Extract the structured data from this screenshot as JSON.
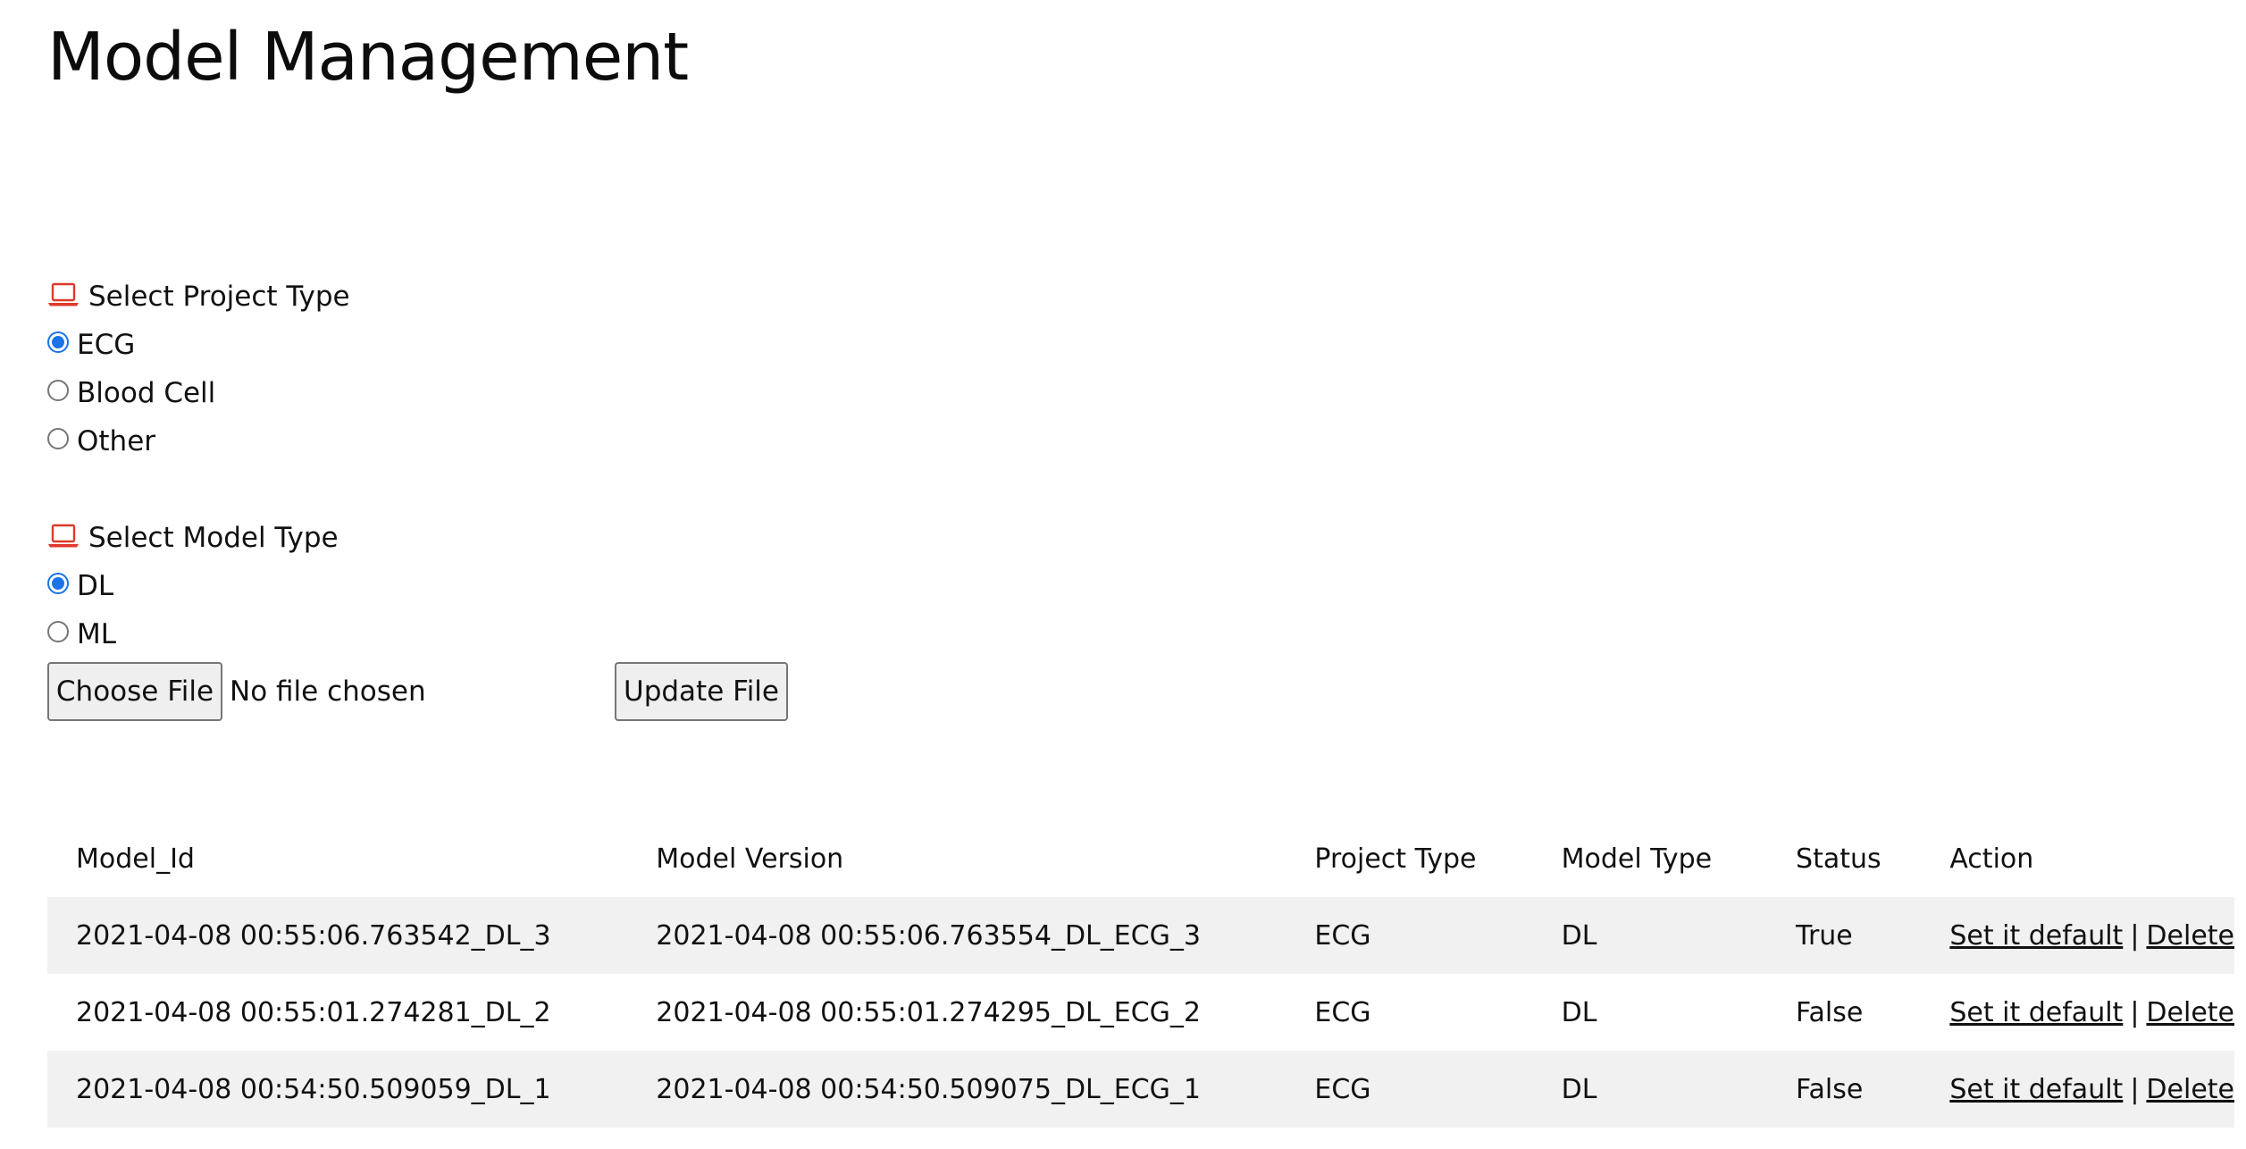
{
  "page": {
    "title": "Model Management"
  },
  "project_type": {
    "heading": "Select Project Type",
    "icon": "laptop-icon",
    "options": [
      {
        "label": "ECG",
        "checked": true
      },
      {
        "label": "Blood Cell",
        "checked": false
      },
      {
        "label": "Other",
        "checked": false
      }
    ]
  },
  "model_type": {
    "heading": "Select Model Type",
    "icon": "laptop-icon",
    "options": [
      {
        "label": "DL",
        "checked": true
      },
      {
        "label": "ML",
        "checked": false
      }
    ]
  },
  "upload": {
    "choose_label": "Choose File",
    "status": "No file chosen",
    "update_label": "Update File"
  },
  "table": {
    "headers": [
      "Model_Id",
      "Model Version",
      "Project Type",
      "Model Type",
      "Status",
      "Action"
    ],
    "rows": [
      {
        "model_id": "2021-04-08 00:55:06.763542_DL_3",
        "model_version": "2021-04-08 00:55:06.763554_DL_ECG_3",
        "project_type": "ECG",
        "model_type": "DL",
        "status": "True",
        "action_default": "Set it default",
        "separator": "|",
        "action_delete": "Delete"
      },
      {
        "model_id": "2021-04-08 00:55:01.274281_DL_2",
        "model_version": "2021-04-08 00:55:01.274295_DL_ECG_2",
        "project_type": "ECG",
        "model_type": "DL",
        "status": "False",
        "action_default": "Set it default",
        "separator": "|",
        "action_delete": "Delete"
      },
      {
        "model_id": "2021-04-08 00:54:50.509059_DL_1",
        "model_version": "2021-04-08 00:54:50.509075_DL_ECG_1",
        "project_type": "ECG",
        "model_type": "DL",
        "status": "False",
        "action_default": "Set it default",
        "separator": "|",
        "action_delete": "Delete"
      }
    ]
  },
  "colors": {
    "accent": "#1a73e8",
    "icon": "#e0392b",
    "row_stripe": "#f1f1f1"
  }
}
